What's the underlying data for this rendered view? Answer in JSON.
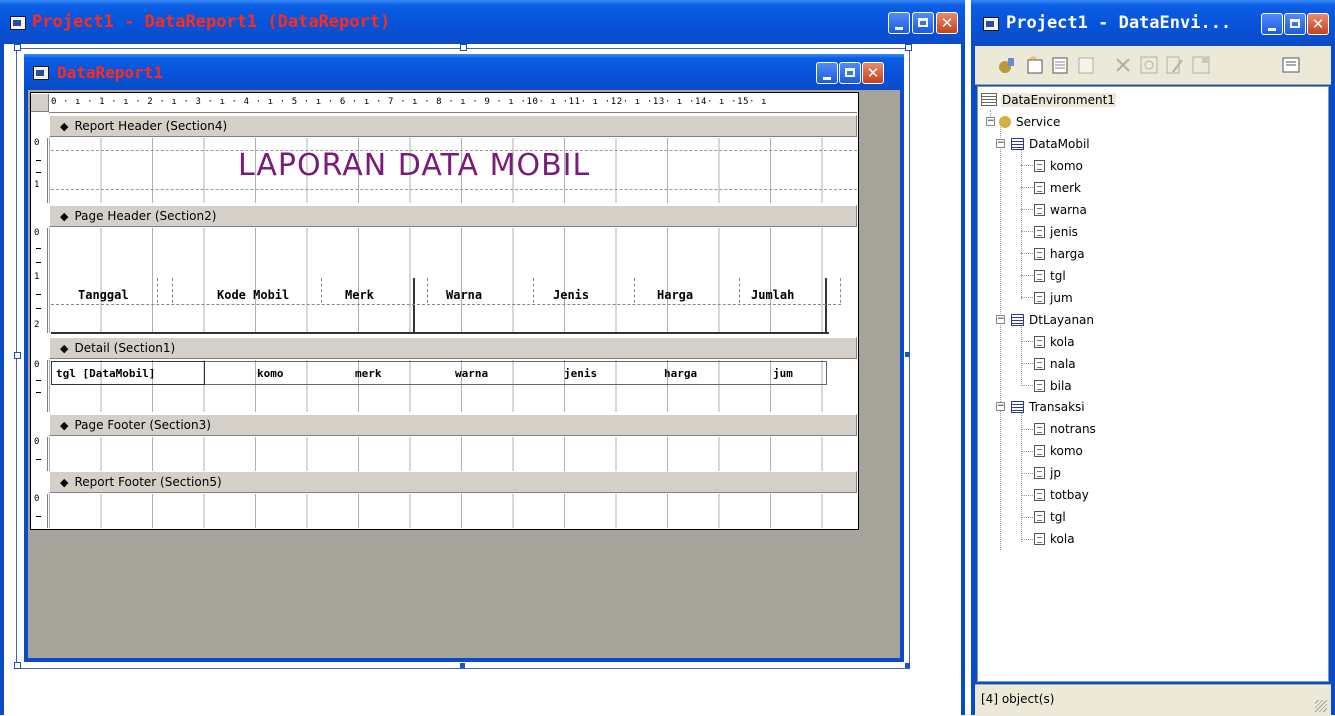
{
  "report_window": {
    "title": "Project1 - DataReport1 (DataReport)",
    "inner_title": "DataReport1",
    "ruler": "0 · ı · 1 · ı · 2 · ı · 3 · ı · 4 · ı · 5 · ı · 6 · ı · 7 · ı · 8 · ı · 9 · ı ·10· ı ·11· ı ·12· ı ·13· ı ·14· ı ·15· ı",
    "sections": [
      {
        "label": "Report Header (Section4)"
      },
      {
        "label": "Page Header (Section2)"
      },
      {
        "label": "Detail (Section1)"
      },
      {
        "label": "Page Footer (Section3)"
      },
      {
        "label": "Report Footer (Section5)"
      }
    ],
    "report_title": "LAPORAN DATA MOBIL",
    "page_header_labels": [
      "Tanggal",
      "Kode Mobil",
      "Merk",
      "Warna",
      "Jenis",
      "Harga",
      "Jumlah"
    ],
    "detail_fields": [
      "tgl [DataMobil]",
      "komo",
      "merk",
      "warna",
      "jenis",
      "harga",
      "jum"
    ],
    "vruler_marks": {
      "zero": "0",
      "one": "1",
      "two": "2"
    }
  },
  "env_window": {
    "title": "Project1 - DataEnvi...",
    "status": "[4] object(s)",
    "tree": {
      "root": "DataEnvironment1",
      "connection": "Service",
      "commands": [
        {
          "name": "DataMobil",
          "fields": [
            "komo",
            "merk",
            "warna",
            "jenis",
            "harga",
            "tgl",
            "jum"
          ]
        },
        {
          "name": "DtLayanan",
          "fields": [
            "kola",
            "nala",
            "bila"
          ]
        },
        {
          "name": "Transaksi",
          "fields": [
            "notrans",
            "komo",
            "jp",
            "totbay",
            "tgl",
            "kola"
          ]
        }
      ]
    },
    "toolbar_icons": [
      "add-connection-icon",
      "add-command-icon",
      "insert-stored-procedures-icon",
      "add-child-command-icon",
      "delete-icon",
      "refresh-icon",
      "design-icon",
      "properties-icon",
      "view-code-icon"
    ]
  },
  "colors": {
    "titlebar_text_report": "#ff2a1a",
    "report_title": "#7a1a7a",
    "xp_blue": "#0a5de3",
    "workspace_gray": "#a6a49a"
  }
}
